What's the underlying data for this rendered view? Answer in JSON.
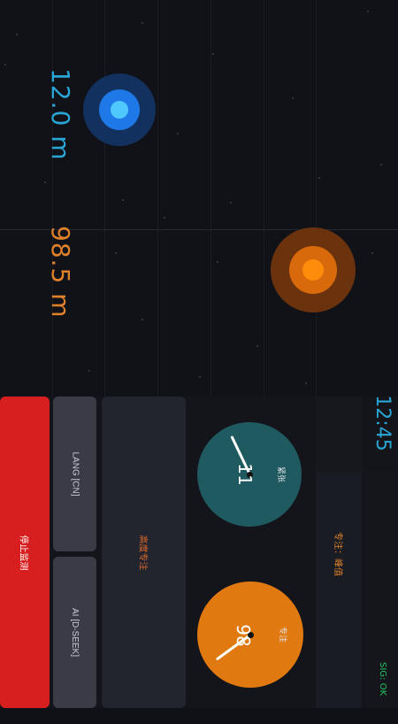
{
  "clock": "12:45",
  "targets": [
    {
      "distance": "12.0 m",
      "color": "#2196f3"
    },
    {
      "distance": "98.5 m",
      "color": "#ff9800"
    }
  ],
  "controls": {
    "stop_label": "停止监测",
    "lang_label": "LANG [CN]",
    "ai_label": "AI [D-SEEK]",
    "mode_label": "高度专注"
  },
  "gauges": {
    "stress": {
      "label": "紧张",
      "value": "11",
      "fraction": 0.11,
      "color": "#1f5a60"
    },
    "focus": {
      "label": "专注",
      "value": "98",
      "fraction": 0.98,
      "color": "#e07a10"
    }
  },
  "status": {
    "focus_state": "专注：峰值",
    "signal": "SIG: OK"
  },
  "colors": {
    "stop": "#d71f1f",
    "accent_blue": "#2aa6d6",
    "accent_orange": "#e0822a"
  }
}
